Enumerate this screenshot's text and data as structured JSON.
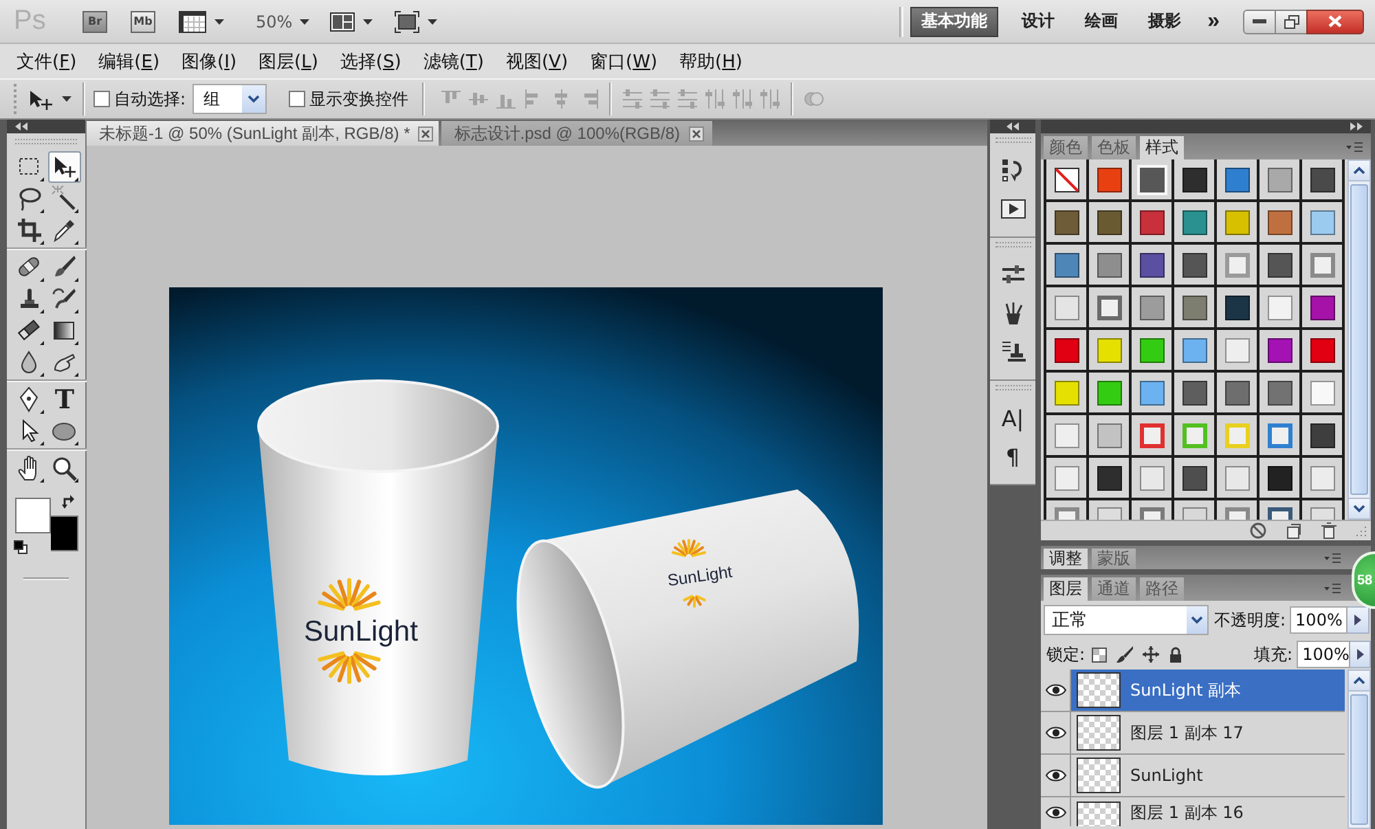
{
  "app_bar": {
    "logo": "Ps",
    "bridge": "Br",
    "mini_bridge": "Mb",
    "zoom": "50%",
    "workspaces": [
      {
        "label": "基本功能",
        "selected": true
      },
      {
        "label": "设计",
        "selected": false
      },
      {
        "label": "绘画",
        "selected": false
      },
      {
        "label": "摄影",
        "selected": false
      }
    ],
    "more": "»"
  },
  "menu": [
    {
      "prefix": "文件(",
      "mnemonic": "F",
      "suffix": ")"
    },
    {
      "prefix": "编辑(",
      "mnemonic": "E",
      "suffix": ")"
    },
    {
      "prefix": "图像(",
      "mnemonic": "I",
      "suffix": ")"
    },
    {
      "prefix": "图层(",
      "mnemonic": "L",
      "suffix": ")"
    },
    {
      "prefix": "选择(",
      "mnemonic": "S",
      "suffix": ")"
    },
    {
      "prefix": "滤镜(",
      "mnemonic": "T",
      "suffix": ")"
    },
    {
      "prefix": "视图(",
      "mnemonic": "V",
      "suffix": ")"
    },
    {
      "prefix": "窗口(",
      "mnemonic": "W",
      "suffix": ")"
    },
    {
      "prefix": "帮助(",
      "mnemonic": "H",
      "suffix": ")"
    }
  ],
  "options_bar": {
    "auto_select": {
      "label": "自动选择:",
      "checked": false
    },
    "auto_select_target": "组",
    "show_transform": {
      "label": "显示变换控件",
      "checked": false
    },
    "align_groups": [
      {
        "buttons": [
          {
            "kind": "align_top",
            "disabled": true
          },
          {
            "kind": "align_middle",
            "disabled": true
          },
          {
            "kind": "align_bottom",
            "disabled": true
          },
          {
            "kind": "align_left",
            "disabled": true
          },
          {
            "kind": "align_center",
            "disabled": true
          },
          {
            "kind": "align_right",
            "disabled": true
          }
        ]
      },
      {
        "buttons": [
          {
            "kind": "distribute_rows",
            "disabled": true
          },
          {
            "kind": "distribute_rows",
            "disabled": true
          },
          {
            "kind": "distribute_rows",
            "disabled": true
          },
          {
            "kind": "distribute_columns",
            "disabled": true
          },
          {
            "kind": "distribute_columns",
            "disabled": true
          },
          {
            "kind": "distribute_columns",
            "disabled": true
          }
        ]
      },
      {
        "buttons": [
          {
            "kind": "auto_align",
            "disabled": true
          }
        ]
      }
    ]
  },
  "toolbox": {
    "groups": [
      {
        "tools": [
          {
            "kind": "marquee",
            "selected": false
          },
          {
            "kind": "move",
            "selected": true
          },
          {
            "kind": "lasso",
            "selected": false
          },
          {
            "kind": "magic_wand",
            "selected": false
          },
          {
            "kind": "crop",
            "selected": false
          },
          {
            "kind": "eyedropper",
            "selected": false
          }
        ]
      },
      {
        "tools": [
          {
            "kind": "healing_brush",
            "selected": false
          },
          {
            "kind": "brush",
            "selected": false
          },
          {
            "kind": "clone_stamp",
            "selected": false
          },
          {
            "kind": "history_brush",
            "selected": false
          },
          {
            "kind": "eraser",
            "selected": false
          },
          {
            "kind": "gradient",
            "selected": false
          },
          {
            "kind": "blur",
            "selected": false
          },
          {
            "kind": "smudge",
            "selected": false
          }
        ]
      },
      {
        "tools": [
          {
            "kind": "pen",
            "selected": false
          },
          {
            "kind": "type",
            "glyph": "T",
            "selected": false
          },
          {
            "kind": "path_selection",
            "selected": false
          },
          {
            "kind": "ellipse",
            "selected": false
          }
        ]
      },
      {
        "tools": [
          {
            "kind": "hand",
            "selected": false
          },
          {
            "kind": "zoom",
            "selected": false
          }
        ]
      }
    ],
    "color_swatches": [
      {
        "kind": "foreground",
        "color": "#ffffff"
      },
      {
        "kind": "background",
        "color": "#000000"
      }
    ]
  },
  "doc_tabs": [
    {
      "label": "未标题-1 @ 50% (SunLight 副本, RGB/8) *",
      "selected": true
    },
    {
      "label": "标志设计.psd @ 100%(RGB/8)",
      "selected": false
    }
  ],
  "document": {
    "cups": [
      {
        "kind": "upright",
        "logo": "SunLight"
      },
      {
        "kind": "lying",
        "logo": "SunLight"
      }
    ]
  },
  "dock": [
    {
      "items": [
        {
          "kind": "history"
        },
        {
          "kind": "actions"
        }
      ]
    },
    {
      "items": [
        {
          "kind": "adjustments"
        },
        {
          "kind": "brush_presets"
        },
        {
          "kind": "clone_source"
        }
      ]
    },
    {
      "items": [
        {
          "kind": "character",
          "glyph": "A|"
        },
        {
          "kind": "paragraph",
          "glyph": "¶"
        }
      ]
    }
  ],
  "styles_panel": {
    "tabs": [
      {
        "label": "颜色",
        "selected": false
      },
      {
        "label": "色板",
        "selected": false
      },
      {
        "label": "样式",
        "selected": true
      }
    ],
    "swatches": [
      {
        "kind": "none"
      },
      {
        "kind": "fill",
        "color": "#e84010"
      },
      {
        "kind": "glow",
        "color": "#575757"
      },
      {
        "kind": "fill",
        "color": "#2e2e2e"
      },
      {
        "kind": "fill",
        "color": "#2f7fd0"
      },
      {
        "kind": "fill",
        "color": "#a9a9a9"
      },
      {
        "kind": "fill",
        "color": "#4a4a4a"
      },
      {
        "kind": "fill",
        "color": "#6e5c38"
      },
      {
        "kind": "fill",
        "color": "#6a5a32"
      },
      {
        "kind": "fill",
        "color": "#c8303c"
      },
      {
        "kind": "fill",
        "color": "#2a9090"
      },
      {
        "kind": "fill",
        "color": "#d6c000"
      },
      {
        "kind": "fill",
        "color": "#c07040"
      },
      {
        "kind": "fill",
        "color": "#9ccbf0"
      },
      {
        "kind": "fill",
        "color": "#4f86b8"
      },
      {
        "kind": "fill",
        "color": "#8e8e8e"
      },
      {
        "kind": "fill",
        "color": "#5a4fa0"
      },
      {
        "kind": "fill",
        "color": "#555555"
      },
      {
        "kind": "frame",
        "color": "#9a9a9a"
      },
      {
        "kind": "fill",
        "color": "#555555"
      },
      {
        "kind": "frame",
        "color": "#8a8a8a"
      },
      {
        "kind": "fill",
        "color": "#e4e4e4"
      },
      {
        "kind": "frame",
        "color": "#6a6a6a"
      },
      {
        "kind": "fill",
        "color": "#9c9c9c"
      },
      {
        "kind": "fill",
        "color": "#7e7e70"
      },
      {
        "kind": "fill",
        "color": "#1c3546"
      },
      {
        "kind": "fill",
        "color": "#f2f2f2"
      },
      {
        "kind": "fill",
        "color": "#a412a8"
      },
      {
        "kind": "fill",
        "color": "#e00012"
      },
      {
        "kind": "fill",
        "color": "#e6e000"
      },
      {
        "kind": "fill",
        "color": "#34cc12"
      },
      {
        "kind": "fill",
        "color": "#6cb2f0"
      },
      {
        "kind": "fill",
        "color": "#eeeeee"
      },
      {
        "kind": "fill",
        "color": "#a412b4"
      },
      {
        "kind": "fill",
        "color": "#e00012"
      },
      {
        "kind": "fill",
        "color": "#e6e000"
      },
      {
        "kind": "fill",
        "color": "#34cc12"
      },
      {
        "kind": "fill",
        "color": "#6cb2f0"
      },
      {
        "kind": "fill",
        "color": "#5e5e5e"
      },
      {
        "kind": "fill",
        "color": "#6e6e6e"
      },
      {
        "kind": "fill",
        "color": "#727272"
      },
      {
        "kind": "fill",
        "color": "#f8f8f8"
      },
      {
        "kind": "fill",
        "color": "#eeeeee"
      },
      {
        "kind": "fill",
        "color": "#c2c2c2"
      },
      {
        "kind": "frame",
        "color": "#e03030"
      },
      {
        "kind": "frame",
        "color": "#52c020"
      },
      {
        "kind": "frame",
        "color": "#e8d020"
      },
      {
        "kind": "frame",
        "color": "#3080d0"
      },
      {
        "kind": "fill",
        "color": "#3e3e3e"
      },
      {
        "kind": "fill",
        "color": "#eeeeee"
      },
      {
        "kind": "fill",
        "color": "#2e2e2e"
      },
      {
        "kind": "fill",
        "color": "#e8e8e8"
      },
      {
        "kind": "fill",
        "color": "#4e4e4e"
      },
      {
        "kind": "fill",
        "color": "#e8e8e8"
      },
      {
        "kind": "fill",
        "color": "#222222"
      },
      {
        "kind": "fill",
        "color": "#ececec"
      },
      {
        "kind": "frame",
        "color": "#8a8a8a"
      },
      {
        "kind": "fill",
        "color": "#dddddd"
      },
      {
        "kind": "frame",
        "color": "#7a7a7a"
      },
      {
        "kind": "fill",
        "color": "#d8d8d8"
      },
      {
        "kind": "frame",
        "color": "#8a8a8a"
      },
      {
        "kind": "frame",
        "color": "#3a5a7a"
      },
      {
        "kind": "fill",
        "color": "#e0e0e0"
      }
    ]
  },
  "adjustments_panel": {
    "tabs": [
      {
        "label": "调整",
        "selected": true
      },
      {
        "label": "蒙版",
        "selected": false
      }
    ]
  },
  "layers_panel": {
    "tabs": [
      {
        "label": "图层",
        "selected": true
      },
      {
        "label": "通道",
        "selected": false
      },
      {
        "label": "路径",
        "selected": false
      }
    ],
    "blend_mode": "正常",
    "opacity_label": "不透明度:",
    "opacity": "100%",
    "lock_label": "锁定:",
    "fill_label": "填充:",
    "fill": "100%",
    "layers": [
      {
        "name": "SunLight 副本",
        "visible": true,
        "selected": true
      },
      {
        "name": "图层 1 副本 17",
        "visible": true,
        "selected": false
      },
      {
        "name": "SunLight",
        "visible": true,
        "selected": false
      },
      {
        "name": "图层 1 副本 16",
        "visible": true,
        "selected": false
      }
    ]
  },
  "badge": "58"
}
